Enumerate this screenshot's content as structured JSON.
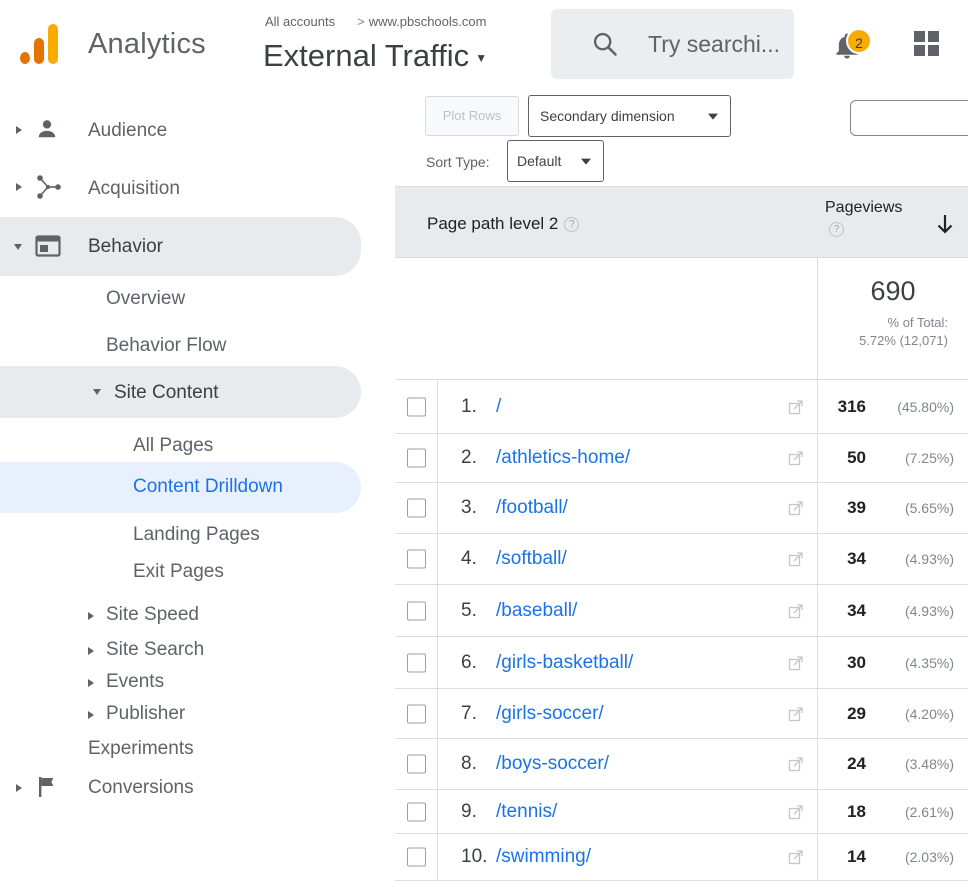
{
  "header": {
    "app_name": "Analytics",
    "breadcrumb_account": "All accounts",
    "breadcrumb_sep": ">",
    "breadcrumb_property": "www.pbschools.com",
    "view_title": "External Traffic",
    "search_placeholder": "Try searchi...",
    "notification_count": "2"
  },
  "sidebar": {
    "audience": "Audience",
    "acquisition": "Acquisition",
    "behavior": "Behavior",
    "overview": "Overview",
    "behavior_flow": "Behavior Flow",
    "site_content": "Site Content",
    "all_pages": "All Pages",
    "content_drilldown": "Content Drilldown",
    "landing_pages": "Landing Pages",
    "exit_pages": "Exit Pages",
    "site_speed": "Site Speed",
    "site_search": "Site Search",
    "events": "Events",
    "publisher": "Publisher",
    "experiments": "Experiments",
    "conversions": "Conversions"
  },
  "toolbar": {
    "plot_rows": "Plot Rows",
    "secondary_dimension": "Secondary dimension",
    "sort_type_label": "Sort Type:",
    "sort_type_value": "Default"
  },
  "table": {
    "dimension_header": "Page path level 2",
    "metric_header": "Pageviews",
    "help_glyph": "?",
    "summary_value": "690",
    "summary_pct_label": "% of Total:",
    "summary_pct_value": "5.72% (12,071)",
    "rows": [
      {
        "index": "1.",
        "path": "/",
        "value": "316",
        "pct": "(45.80%)"
      },
      {
        "index": "2.",
        "path": "/athletics-home/",
        "value": "50",
        "pct": "(7.25%)"
      },
      {
        "index": "3.",
        "path": "/football/",
        "value": "39",
        "pct": "(5.65%)"
      },
      {
        "index": "4.",
        "path": "/softball/",
        "value": "34",
        "pct": "(4.93%)"
      },
      {
        "index": "5.",
        "path": "/baseball/",
        "value": "34",
        "pct": "(4.93%)"
      },
      {
        "index": "6.",
        "path": "/girls-basketball/",
        "value": "30",
        "pct": "(4.35%)"
      },
      {
        "index": "7.",
        "path": "/girls-soccer/",
        "value": "29",
        "pct": "(4.20%)"
      },
      {
        "index": "8.",
        "path": "/boys-soccer/",
        "value": "24",
        "pct": "(3.48%)"
      },
      {
        "index": "9.",
        "path": "/tennis/",
        "value": "18",
        "pct": "(2.61%)"
      },
      {
        "index": "10.",
        "path": "/swimming/",
        "value": "14",
        "pct": "(2.03%)"
      }
    ]
  },
  "colors": {
    "accent": "#1a73e8",
    "logo_orange": "#e37400",
    "logo_yellow": "#f9ab00",
    "selected_bg": "#e8f0fe",
    "section_bg": "#e8eaed"
  }
}
